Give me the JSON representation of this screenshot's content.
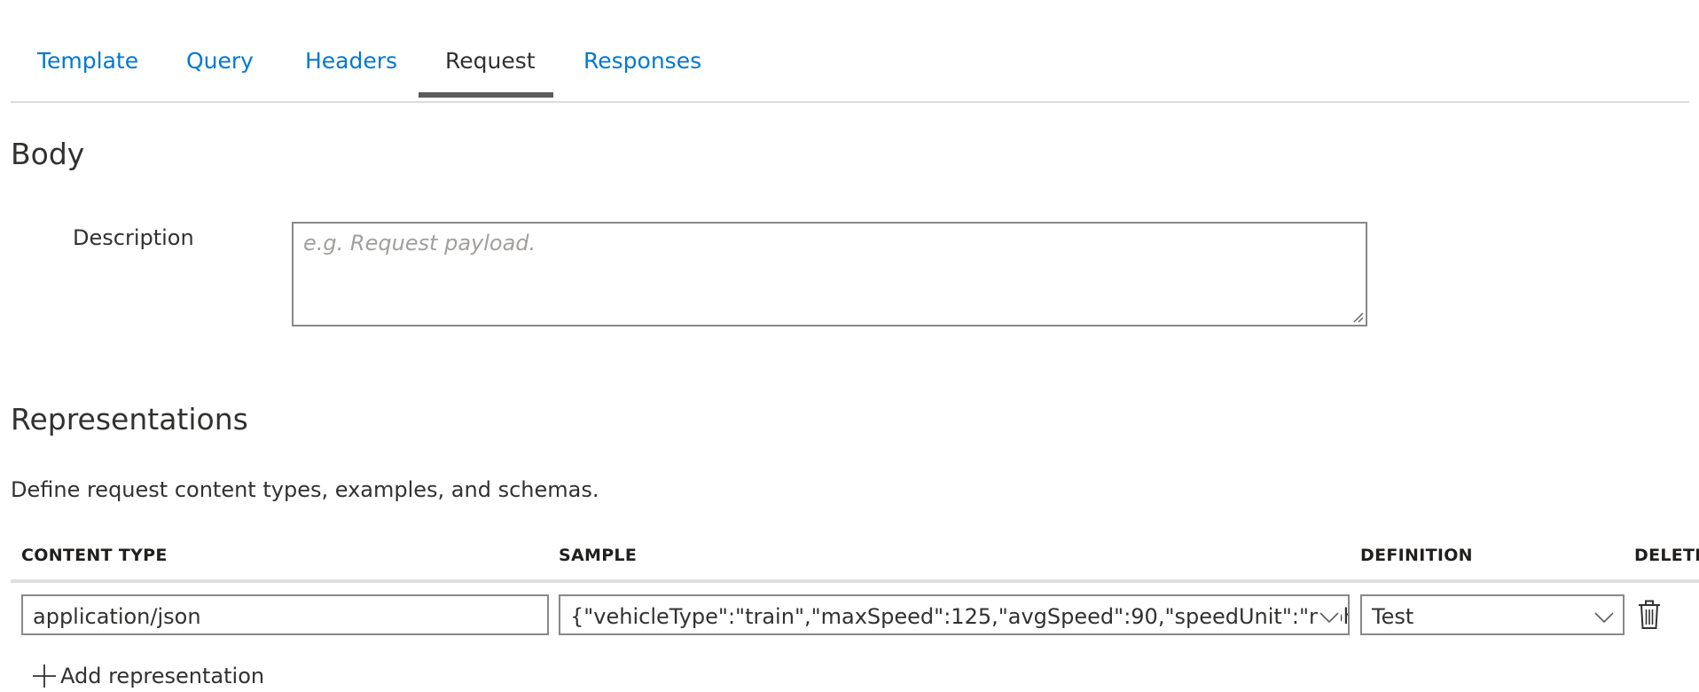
{
  "tabs": [
    {
      "label": "Template",
      "active": false
    },
    {
      "label": "Query",
      "active": false
    },
    {
      "label": "Headers",
      "active": false
    },
    {
      "label": "Request",
      "active": true
    },
    {
      "label": "Responses",
      "active": false
    }
  ],
  "body": {
    "heading": "Body",
    "description_label": "Description",
    "description_value": "",
    "description_placeholder": "e.g. Request payload."
  },
  "representations": {
    "heading": "Representations",
    "description": "Define request content types, examples, and schemas.",
    "columns": {
      "content_type": "CONTENT TYPE",
      "sample": "SAMPLE",
      "definition": "DEFINITION",
      "delete": "DELETE"
    },
    "rows": [
      {
        "content_type": "application/json",
        "sample": "{\"vehicleType\":\"train\",\"maxSpeed\":125,\"avgSpeed\":90,\"speedUnit\":\"mph\"}",
        "definition": "Test"
      }
    ],
    "add_label": "Add representation"
  },
  "icons": {
    "sample_dropdown": "chevron-down-icon",
    "definition_dropdown": "chevron-down-icon",
    "delete": "trash-icon",
    "add": "plus-icon"
  },
  "colors": {
    "accent": "#0078d4",
    "text": "#323130",
    "border": "#8a8886",
    "tab_underline": "#5a5a5a"
  }
}
